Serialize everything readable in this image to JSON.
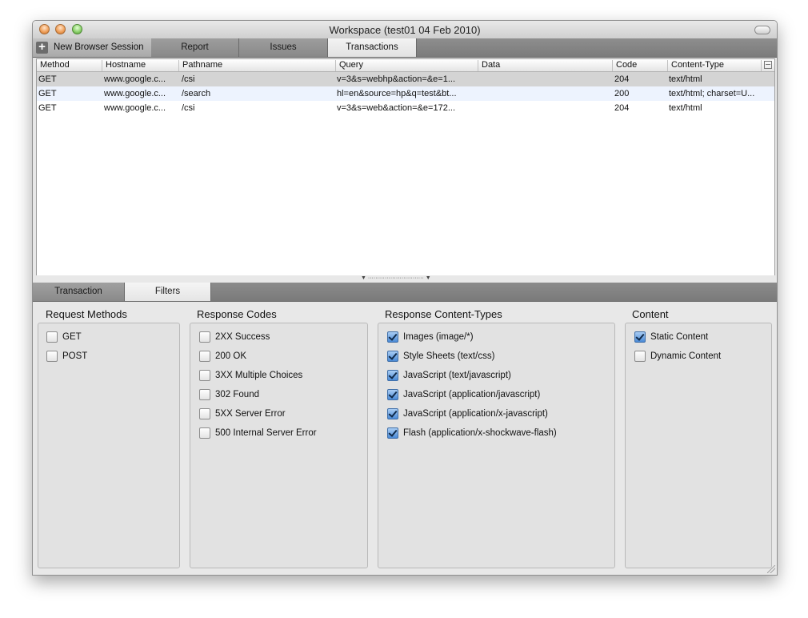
{
  "window": {
    "title": "Workspace (test01 04 Feb 2010)"
  },
  "toolbar": {
    "new_session_label": "New Browser Session"
  },
  "tabs": [
    {
      "label": "Report",
      "active": false
    },
    {
      "label": "Issues",
      "active": false
    },
    {
      "label": "Transactions",
      "active": true
    }
  ],
  "table": {
    "columns": [
      "Method",
      "Hostname",
      "Pathname",
      "Query",
      "Data",
      "Code",
      "Content-Type"
    ],
    "rows": [
      [
        "GET",
        "www.google.c...",
        "/csi",
        "v=3&s=webhp&action=&e=1...",
        "",
        "204",
        "text/html"
      ],
      [
        "GET",
        "www.google.c...",
        "/search",
        "hl=en&source=hp&q=test&bt...",
        "",
        "200",
        "text/html; charset=U..."
      ],
      [
        "GET",
        "www.google.c...",
        "/csi",
        "v=3&s=web&action=&e=172...",
        "",
        "204",
        "text/html"
      ]
    ]
  },
  "bottom_tabs": [
    {
      "label": "Transaction",
      "active": false
    },
    {
      "label": "Filters",
      "active": true
    }
  ],
  "filters": {
    "request_methods": {
      "title": "Request Methods",
      "options": [
        {
          "label": "GET",
          "checked": false
        },
        {
          "label": "POST",
          "checked": false
        }
      ]
    },
    "response_codes": {
      "title": "Response Codes",
      "options": [
        {
          "label": "2XX Success",
          "checked": false
        },
        {
          "label": "200 OK",
          "checked": false
        },
        {
          "label": "3XX Multiple Choices",
          "checked": false
        },
        {
          "label": "302 Found",
          "checked": false
        },
        {
          "label": "5XX Server Error",
          "checked": false
        },
        {
          "label": "500 Internal Server Error",
          "checked": false
        }
      ]
    },
    "content_types": {
      "title": "Response Content-Types",
      "options": [
        {
          "label": "Images (image/*)",
          "checked": true
        },
        {
          "label": "Style Sheets (text/css)",
          "checked": true
        },
        {
          "label": "JavaScript (text/javascript)",
          "checked": true
        },
        {
          "label": "JavaScript (application/javascript)",
          "checked": true
        },
        {
          "label": "JavaScript (application/x-javascript)",
          "checked": true
        },
        {
          "label": "Flash (application/x-shockwave-flash)",
          "checked": true
        }
      ]
    },
    "content": {
      "title": "Content",
      "options": [
        {
          "label": "Static Content",
          "checked": true
        },
        {
          "label": "Dynamic Content",
          "checked": false
        }
      ]
    }
  },
  "icons": {
    "traffic_lights": [
      "close-icon",
      "minimize-icon",
      "zoom-icon"
    ],
    "toolbar_toggle": "toolbar-toggle-icon",
    "new_session": "plus-icon",
    "column_chooser": "column-chooser-icon",
    "splitter": "splitter-grip-icon",
    "resize": "resize-grip-icon"
  }
}
